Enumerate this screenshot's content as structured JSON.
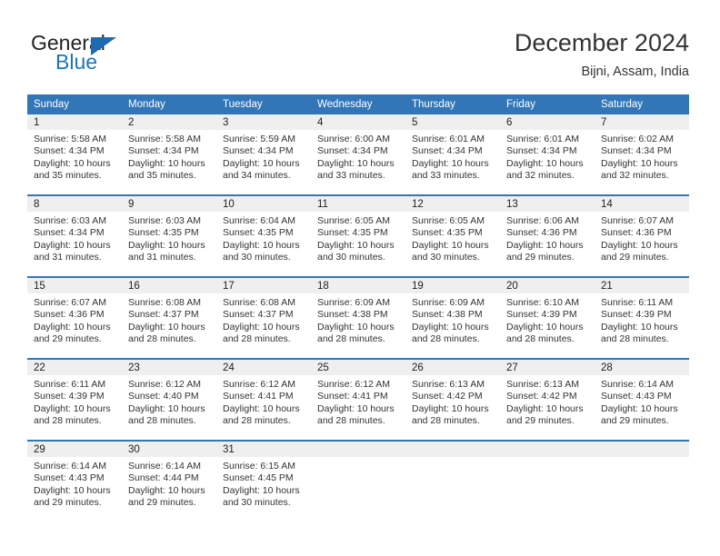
{
  "brand": {
    "name_part1": "General",
    "name_part2": "Blue",
    "accent_color": "#1b6cb0"
  },
  "header": {
    "title": "December 2024",
    "subtitle": "Bijni, Assam, India"
  },
  "theme": {
    "header_bg": "#3276b8",
    "daynum_bg": "#efefef",
    "row_separator": "#3276b8"
  },
  "weekday_headers": [
    "Sunday",
    "Monday",
    "Tuesday",
    "Wednesday",
    "Thursday",
    "Friday",
    "Saturday"
  ],
  "weeks": [
    [
      {
        "day": "1",
        "sunrise": "Sunrise: 5:58 AM",
        "sunset": "Sunset: 4:34 PM",
        "daylight1": "Daylight: 10 hours",
        "daylight2": "and 35 minutes."
      },
      {
        "day": "2",
        "sunrise": "Sunrise: 5:58 AM",
        "sunset": "Sunset: 4:34 PM",
        "daylight1": "Daylight: 10 hours",
        "daylight2": "and 35 minutes."
      },
      {
        "day": "3",
        "sunrise": "Sunrise: 5:59 AM",
        "sunset": "Sunset: 4:34 PM",
        "daylight1": "Daylight: 10 hours",
        "daylight2": "and 34 minutes."
      },
      {
        "day": "4",
        "sunrise": "Sunrise: 6:00 AM",
        "sunset": "Sunset: 4:34 PM",
        "daylight1": "Daylight: 10 hours",
        "daylight2": "and 33 minutes."
      },
      {
        "day": "5",
        "sunrise": "Sunrise: 6:01 AM",
        "sunset": "Sunset: 4:34 PM",
        "daylight1": "Daylight: 10 hours",
        "daylight2": "and 33 minutes."
      },
      {
        "day": "6",
        "sunrise": "Sunrise: 6:01 AM",
        "sunset": "Sunset: 4:34 PM",
        "daylight1": "Daylight: 10 hours",
        "daylight2": "and 32 minutes."
      },
      {
        "day": "7",
        "sunrise": "Sunrise: 6:02 AM",
        "sunset": "Sunset: 4:34 PM",
        "daylight1": "Daylight: 10 hours",
        "daylight2": "and 32 minutes."
      }
    ],
    [
      {
        "day": "8",
        "sunrise": "Sunrise: 6:03 AM",
        "sunset": "Sunset: 4:34 PM",
        "daylight1": "Daylight: 10 hours",
        "daylight2": "and 31 minutes."
      },
      {
        "day": "9",
        "sunrise": "Sunrise: 6:03 AM",
        "sunset": "Sunset: 4:35 PM",
        "daylight1": "Daylight: 10 hours",
        "daylight2": "and 31 minutes."
      },
      {
        "day": "10",
        "sunrise": "Sunrise: 6:04 AM",
        "sunset": "Sunset: 4:35 PM",
        "daylight1": "Daylight: 10 hours",
        "daylight2": "and 30 minutes."
      },
      {
        "day": "11",
        "sunrise": "Sunrise: 6:05 AM",
        "sunset": "Sunset: 4:35 PM",
        "daylight1": "Daylight: 10 hours",
        "daylight2": "and 30 minutes."
      },
      {
        "day": "12",
        "sunrise": "Sunrise: 6:05 AM",
        "sunset": "Sunset: 4:35 PM",
        "daylight1": "Daylight: 10 hours",
        "daylight2": "and 30 minutes."
      },
      {
        "day": "13",
        "sunrise": "Sunrise: 6:06 AM",
        "sunset": "Sunset: 4:36 PM",
        "daylight1": "Daylight: 10 hours",
        "daylight2": "and 29 minutes."
      },
      {
        "day": "14",
        "sunrise": "Sunrise: 6:07 AM",
        "sunset": "Sunset: 4:36 PM",
        "daylight1": "Daylight: 10 hours",
        "daylight2": "and 29 minutes."
      }
    ],
    [
      {
        "day": "15",
        "sunrise": "Sunrise: 6:07 AM",
        "sunset": "Sunset: 4:36 PM",
        "daylight1": "Daylight: 10 hours",
        "daylight2": "and 29 minutes."
      },
      {
        "day": "16",
        "sunrise": "Sunrise: 6:08 AM",
        "sunset": "Sunset: 4:37 PM",
        "daylight1": "Daylight: 10 hours",
        "daylight2": "and 28 minutes."
      },
      {
        "day": "17",
        "sunrise": "Sunrise: 6:08 AM",
        "sunset": "Sunset: 4:37 PM",
        "daylight1": "Daylight: 10 hours",
        "daylight2": "and 28 minutes."
      },
      {
        "day": "18",
        "sunrise": "Sunrise: 6:09 AM",
        "sunset": "Sunset: 4:38 PM",
        "daylight1": "Daylight: 10 hours",
        "daylight2": "and 28 minutes."
      },
      {
        "day": "19",
        "sunrise": "Sunrise: 6:09 AM",
        "sunset": "Sunset: 4:38 PM",
        "daylight1": "Daylight: 10 hours",
        "daylight2": "and 28 minutes."
      },
      {
        "day": "20",
        "sunrise": "Sunrise: 6:10 AM",
        "sunset": "Sunset: 4:39 PM",
        "daylight1": "Daylight: 10 hours",
        "daylight2": "and 28 minutes."
      },
      {
        "day": "21",
        "sunrise": "Sunrise: 6:11 AM",
        "sunset": "Sunset: 4:39 PM",
        "daylight1": "Daylight: 10 hours",
        "daylight2": "and 28 minutes."
      }
    ],
    [
      {
        "day": "22",
        "sunrise": "Sunrise: 6:11 AM",
        "sunset": "Sunset: 4:39 PM",
        "daylight1": "Daylight: 10 hours",
        "daylight2": "and 28 minutes."
      },
      {
        "day": "23",
        "sunrise": "Sunrise: 6:12 AM",
        "sunset": "Sunset: 4:40 PM",
        "daylight1": "Daylight: 10 hours",
        "daylight2": "and 28 minutes."
      },
      {
        "day": "24",
        "sunrise": "Sunrise: 6:12 AM",
        "sunset": "Sunset: 4:41 PM",
        "daylight1": "Daylight: 10 hours",
        "daylight2": "and 28 minutes."
      },
      {
        "day": "25",
        "sunrise": "Sunrise: 6:12 AM",
        "sunset": "Sunset: 4:41 PM",
        "daylight1": "Daylight: 10 hours",
        "daylight2": "and 28 minutes."
      },
      {
        "day": "26",
        "sunrise": "Sunrise: 6:13 AM",
        "sunset": "Sunset: 4:42 PM",
        "daylight1": "Daylight: 10 hours",
        "daylight2": "and 28 minutes."
      },
      {
        "day": "27",
        "sunrise": "Sunrise: 6:13 AM",
        "sunset": "Sunset: 4:42 PM",
        "daylight1": "Daylight: 10 hours",
        "daylight2": "and 29 minutes."
      },
      {
        "day": "28",
        "sunrise": "Sunrise: 6:14 AM",
        "sunset": "Sunset: 4:43 PM",
        "daylight1": "Daylight: 10 hours",
        "daylight2": "and 29 minutes."
      }
    ],
    [
      {
        "day": "29",
        "sunrise": "Sunrise: 6:14 AM",
        "sunset": "Sunset: 4:43 PM",
        "daylight1": "Daylight: 10 hours",
        "daylight2": "and 29 minutes."
      },
      {
        "day": "30",
        "sunrise": "Sunrise: 6:14 AM",
        "sunset": "Sunset: 4:44 PM",
        "daylight1": "Daylight: 10 hours",
        "daylight2": "and 29 minutes."
      },
      {
        "day": "31",
        "sunrise": "Sunrise: 6:15 AM",
        "sunset": "Sunset: 4:45 PM",
        "daylight1": "Daylight: 10 hours",
        "daylight2": "and 30 minutes."
      },
      {
        "day": "",
        "sunrise": "",
        "sunset": "",
        "daylight1": "",
        "daylight2": ""
      },
      {
        "day": "",
        "sunrise": "",
        "sunset": "",
        "daylight1": "",
        "daylight2": ""
      },
      {
        "day": "",
        "sunrise": "",
        "sunset": "",
        "daylight1": "",
        "daylight2": ""
      },
      {
        "day": "",
        "sunrise": "",
        "sunset": "",
        "daylight1": "",
        "daylight2": ""
      }
    ]
  ]
}
